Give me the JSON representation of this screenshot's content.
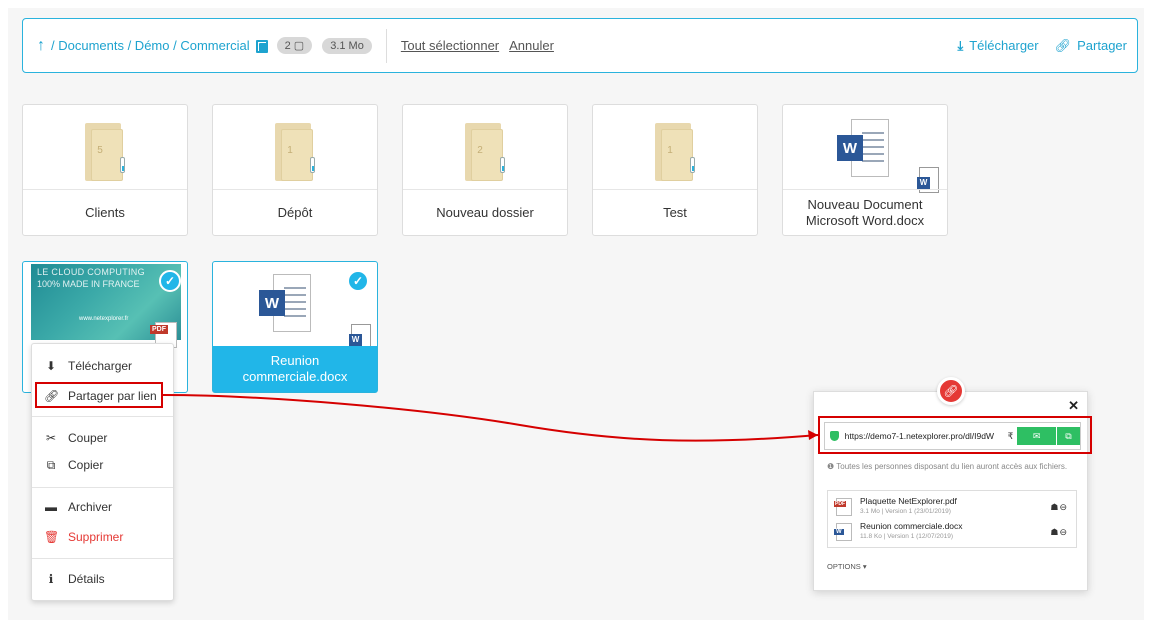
{
  "toolbar": {
    "breadcrumb": "/ Documents / Démo / Commercial",
    "selected_count": "2",
    "size": "3.1 Mo",
    "select_all": "Tout sélectionner",
    "cancel": "Annuler",
    "download": "Télécharger",
    "share": "Partager"
  },
  "tiles": [
    {
      "label": "Clients",
      "count": "5"
    },
    {
      "label": "Dépôt",
      "count": "1"
    },
    {
      "label": "Nouveau dossier",
      "count": "2"
    },
    {
      "label": "Test",
      "count": "1"
    },
    {
      "label": "Nouveau Document Microsoft Word.docx"
    }
  ],
  "selected_tiles": [
    {
      "label": "Plaquette NetExplorer.pdf",
      "thumb_line1": "LE CLOUD COMPUTING",
      "thumb_line2": "100% MADE IN FRANCE",
      "thumb_url": "www.netexplorer.fr",
      "badge": "PDF"
    },
    {
      "label": "Reunion commerciale.docx"
    }
  ],
  "context_menu": [
    {
      "label": "Télécharger",
      "icon": "download-icon"
    },
    {
      "label": "Partager par lien",
      "icon": "link-icon"
    },
    {
      "label": "Couper",
      "icon": "scissors-icon"
    },
    {
      "label": "Copier",
      "icon": "copy-icon"
    },
    {
      "label": "Archiver",
      "icon": "archive-icon"
    },
    {
      "label": "Supprimer",
      "icon": "trash-icon"
    },
    {
      "label": "Détails",
      "icon": "info-icon"
    }
  ],
  "share_panel": {
    "url": "https://demo7-1.netexplorer.pro/dl/I9dW",
    "info": "Toutes les personnes disposant du lien auront accès aux fichiers.",
    "files": [
      {
        "name": "Plaquette NetExplorer.pdf",
        "meta": "3.1 Mo | Version 1 (23/01/2019)"
      },
      {
        "name": "Reunion commerciale.docx",
        "meta": "11.8 Ko | Version 1 (12/07/2019)"
      }
    ],
    "options": "OPTIONS"
  },
  "colors": {
    "accent": "#21b6e8",
    "danger": "#e53935",
    "success": "#2ebf63",
    "highlight": "#d50000"
  }
}
